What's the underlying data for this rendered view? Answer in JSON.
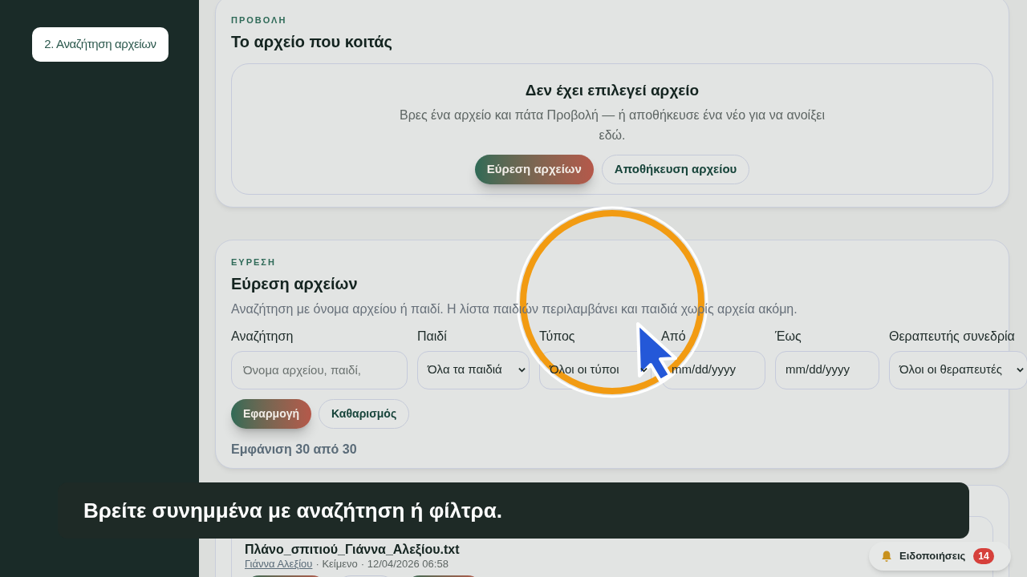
{
  "sidebar": {
    "steps": [
      {
        "label": "2. Αναζήτηση αρχείων",
        "selected": true
      }
    ]
  },
  "preview": {
    "eyebrow": "ΠΡΟΒΟΛΗ",
    "title": "Το αρχείο που κοιτάς",
    "empty_title": "Δεν έχει επιλεγεί αρχείο",
    "empty_text": "Βρες ένα αρχείο και πάτα Προβολή — ή αποθήκευσε ένα νέο για να ανοίξει εδώ.",
    "buttons": [
      {
        "label": "Εύρεση αρχείων",
        "kind": "primary"
      },
      {
        "label": "Αποθήκευση αρχείου",
        "kind": "secondary"
      }
    ]
  },
  "finder": {
    "eyebrow": "ΕΥΡΕΣΗ",
    "title": "Εύρεση αρχείων",
    "description": "Αναζήτηση με όνομα αρχείου ή παιδί. Η λίστα παιδιών περιλαμβάνει και παιδιά χωρίς αρχεία ακόμη.",
    "filters": [
      {
        "label": "Αναζήτηση",
        "kind": "text",
        "placeholder": "Όνομα αρχείου, παιδί,"
      },
      {
        "label": "Παιδί",
        "kind": "select",
        "value": "Όλα τα παιδιά"
      },
      {
        "label": "Τύπος",
        "kind": "select",
        "value": "Όλοι οι τύποι"
      },
      {
        "label": "Από",
        "kind": "date",
        "value": "mm/dd/yyyy"
      },
      {
        "label": "Έως",
        "kind": "date",
        "value": "mm/dd/yyyy"
      },
      {
        "label": "Θεραπευτής συνεδρία",
        "kind": "select",
        "value": "Όλοι οι θεραπευτές"
      }
    ],
    "buttons": [
      {
        "label": "Εφαρμογή",
        "kind": "primary"
      },
      {
        "label": "Καθαρισμός",
        "kind": "secondary"
      }
    ],
    "count": "Εμφάνιση 30 από 30"
  },
  "results": [
    {
      "name": "Πλάνο_σπιτιού_Γιάννα_Αλεξίου.txt",
      "child": "Γιάννα Αλεξίου",
      "type": "· Κείμενο",
      "date": "· 12/04/2026 06:58",
      "buttons": [
        {
          "kind": "primary"
        },
        {
          "kind": "secondary"
        },
        {
          "kind": "primary"
        }
      ]
    }
  ],
  "tour": {
    "caption": "Βρείτε συνημμένα με αναζήτηση ή φίλτρα."
  },
  "notifications": {
    "label": "Ειδοποιήσεις",
    "count": "14"
  }
}
